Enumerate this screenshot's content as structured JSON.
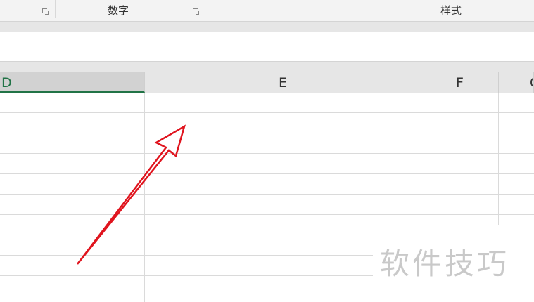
{
  "ribbon": {
    "group_number_label": "数字",
    "group_styles_label": "样式"
  },
  "columns": {
    "d": "D",
    "e": "E",
    "f": "F",
    "g": "G"
  },
  "watermark": {
    "text": "软件技巧"
  },
  "colors": {
    "selected_header": "#217346",
    "annotation_arrow": "#e0141e"
  },
  "icons": [
    "dialog-launcher-icon",
    "annotation-arrow-icon"
  ]
}
